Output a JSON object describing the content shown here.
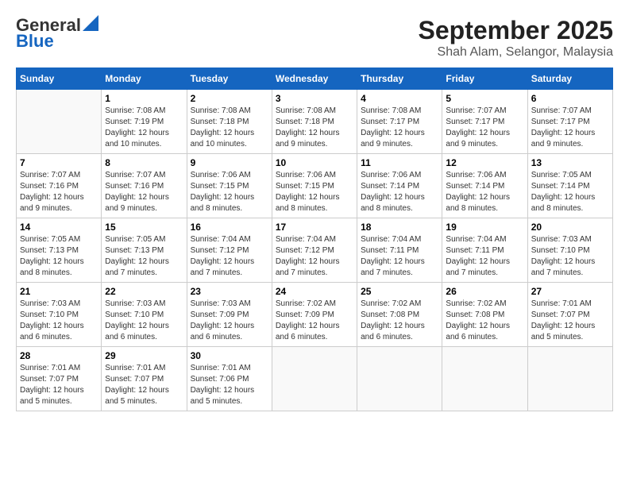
{
  "header": {
    "logo_general": "General",
    "logo_blue": "Blue",
    "month": "September 2025",
    "location": "Shah Alam, Selangor, Malaysia"
  },
  "days_of_week": [
    "Sunday",
    "Monday",
    "Tuesday",
    "Wednesday",
    "Thursday",
    "Friday",
    "Saturday"
  ],
  "weeks": [
    [
      {
        "day": "",
        "info": ""
      },
      {
        "day": "1",
        "info": "Sunrise: 7:08 AM\nSunset: 7:19 PM\nDaylight: 12 hours\nand 10 minutes."
      },
      {
        "day": "2",
        "info": "Sunrise: 7:08 AM\nSunset: 7:18 PM\nDaylight: 12 hours\nand 10 minutes."
      },
      {
        "day": "3",
        "info": "Sunrise: 7:08 AM\nSunset: 7:18 PM\nDaylight: 12 hours\nand 9 minutes."
      },
      {
        "day": "4",
        "info": "Sunrise: 7:08 AM\nSunset: 7:17 PM\nDaylight: 12 hours\nand 9 minutes."
      },
      {
        "day": "5",
        "info": "Sunrise: 7:07 AM\nSunset: 7:17 PM\nDaylight: 12 hours\nand 9 minutes."
      },
      {
        "day": "6",
        "info": "Sunrise: 7:07 AM\nSunset: 7:17 PM\nDaylight: 12 hours\nand 9 minutes."
      }
    ],
    [
      {
        "day": "7",
        "info": "Sunrise: 7:07 AM\nSunset: 7:16 PM\nDaylight: 12 hours\nand 9 minutes."
      },
      {
        "day": "8",
        "info": "Sunrise: 7:07 AM\nSunset: 7:16 PM\nDaylight: 12 hours\nand 9 minutes."
      },
      {
        "day": "9",
        "info": "Sunrise: 7:06 AM\nSunset: 7:15 PM\nDaylight: 12 hours\nand 8 minutes."
      },
      {
        "day": "10",
        "info": "Sunrise: 7:06 AM\nSunset: 7:15 PM\nDaylight: 12 hours\nand 8 minutes."
      },
      {
        "day": "11",
        "info": "Sunrise: 7:06 AM\nSunset: 7:14 PM\nDaylight: 12 hours\nand 8 minutes."
      },
      {
        "day": "12",
        "info": "Sunrise: 7:06 AM\nSunset: 7:14 PM\nDaylight: 12 hours\nand 8 minutes."
      },
      {
        "day": "13",
        "info": "Sunrise: 7:05 AM\nSunset: 7:14 PM\nDaylight: 12 hours\nand 8 minutes."
      }
    ],
    [
      {
        "day": "14",
        "info": "Sunrise: 7:05 AM\nSunset: 7:13 PM\nDaylight: 12 hours\nand 8 minutes."
      },
      {
        "day": "15",
        "info": "Sunrise: 7:05 AM\nSunset: 7:13 PM\nDaylight: 12 hours\nand 7 minutes."
      },
      {
        "day": "16",
        "info": "Sunrise: 7:04 AM\nSunset: 7:12 PM\nDaylight: 12 hours\nand 7 minutes."
      },
      {
        "day": "17",
        "info": "Sunrise: 7:04 AM\nSunset: 7:12 PM\nDaylight: 12 hours\nand 7 minutes."
      },
      {
        "day": "18",
        "info": "Sunrise: 7:04 AM\nSunset: 7:11 PM\nDaylight: 12 hours\nand 7 minutes."
      },
      {
        "day": "19",
        "info": "Sunrise: 7:04 AM\nSunset: 7:11 PM\nDaylight: 12 hours\nand 7 minutes."
      },
      {
        "day": "20",
        "info": "Sunrise: 7:03 AM\nSunset: 7:10 PM\nDaylight: 12 hours\nand 7 minutes."
      }
    ],
    [
      {
        "day": "21",
        "info": "Sunrise: 7:03 AM\nSunset: 7:10 PM\nDaylight: 12 hours\nand 6 minutes."
      },
      {
        "day": "22",
        "info": "Sunrise: 7:03 AM\nSunset: 7:10 PM\nDaylight: 12 hours\nand 6 minutes."
      },
      {
        "day": "23",
        "info": "Sunrise: 7:03 AM\nSunset: 7:09 PM\nDaylight: 12 hours\nand 6 minutes."
      },
      {
        "day": "24",
        "info": "Sunrise: 7:02 AM\nSunset: 7:09 PM\nDaylight: 12 hours\nand 6 minutes."
      },
      {
        "day": "25",
        "info": "Sunrise: 7:02 AM\nSunset: 7:08 PM\nDaylight: 12 hours\nand 6 minutes."
      },
      {
        "day": "26",
        "info": "Sunrise: 7:02 AM\nSunset: 7:08 PM\nDaylight: 12 hours\nand 6 minutes."
      },
      {
        "day": "27",
        "info": "Sunrise: 7:01 AM\nSunset: 7:07 PM\nDaylight: 12 hours\nand 5 minutes."
      }
    ],
    [
      {
        "day": "28",
        "info": "Sunrise: 7:01 AM\nSunset: 7:07 PM\nDaylight: 12 hours\nand 5 minutes."
      },
      {
        "day": "29",
        "info": "Sunrise: 7:01 AM\nSunset: 7:07 PM\nDaylight: 12 hours\nand 5 minutes."
      },
      {
        "day": "30",
        "info": "Sunrise: 7:01 AM\nSunset: 7:06 PM\nDaylight: 12 hours\nand 5 minutes."
      },
      {
        "day": "",
        "info": ""
      },
      {
        "day": "",
        "info": ""
      },
      {
        "day": "",
        "info": ""
      },
      {
        "day": "",
        "info": ""
      }
    ]
  ]
}
